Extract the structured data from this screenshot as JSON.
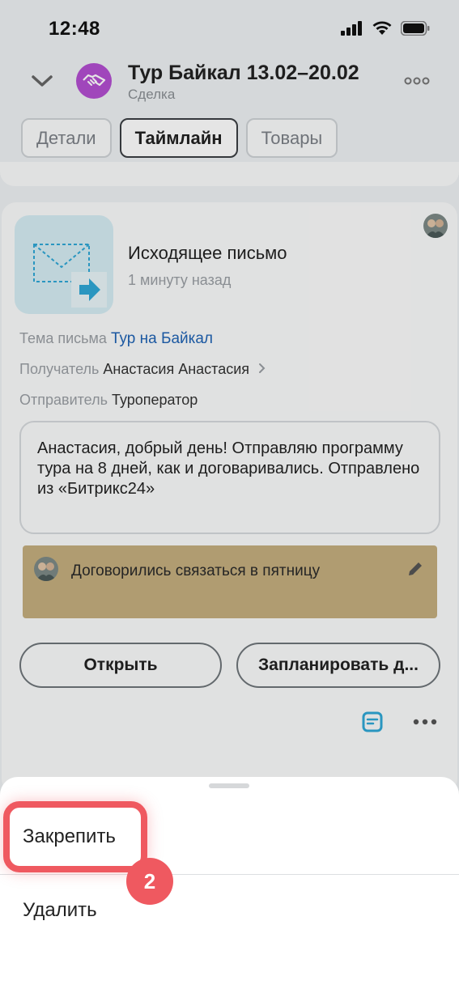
{
  "status_bar": {
    "time": "12:48"
  },
  "header": {
    "title": "Тур Байкал 13.02–20.02",
    "subtitle": "Сделка"
  },
  "tabs": [
    {
      "label": "Детали",
      "active": false
    },
    {
      "label": "Таймлайн",
      "active": true
    },
    {
      "label": "Товары",
      "active": false
    }
  ],
  "activity": {
    "title": "Исходящее письмо",
    "time": "1 минуту назад",
    "subject_label": "Тема письма",
    "subject_value": "Тур на Байкал",
    "recipient_label": "Получатель",
    "recipient_value": "Анастасия Анастасия",
    "sender_label": "Отправитель",
    "sender_value": "Туроператор",
    "message": "Анастасия, добрый день! Отправляю программу тура на 8 дней, как и договаривались. Отправлено из «Битрикс24»",
    "note": "Договорились связаться в пятницу",
    "open_button": "Открыть",
    "plan_button": "Запланировать д..."
  },
  "sheet": {
    "pin_label": "Закрепить",
    "delete_label": "Удалить"
  },
  "annotation": {
    "step": "2"
  },
  "colors": {
    "accent_link": "#1f63b4",
    "deal_avatar": "#b34fd1",
    "note_bg": "#c4ae7e",
    "highlight": "#ef5960",
    "mail_icon": "#2fa7d6"
  }
}
